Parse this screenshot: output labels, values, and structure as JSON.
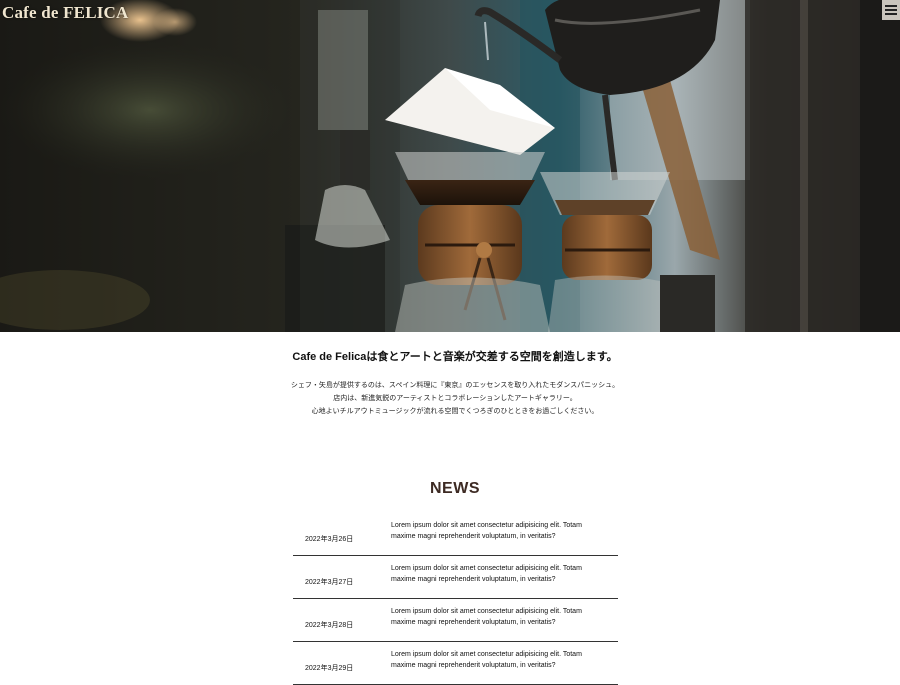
{
  "header": {
    "logo_text": "Cafe de FELICA",
    "menu_icon": "hamburger-menu-icon"
  },
  "hero": {
    "image_description_icon": "coffee-pour-over-photo"
  },
  "intro": {
    "title": "Cafe de Felicaは食とアートと音楽が交差する空間を創造します。",
    "lines": [
      "シェフ・矢島が提供するのは、スペイン料理に『東京』のエッセンスを取り入れたモダンスパニッシュ。",
      "店内は、新進気鋭のアーティストとコラボレーションしたアートギャラリー。",
      "心地よいチルアウトミュージックが流れる空間でくつろぎのひとときをお過ごしください。"
    ]
  },
  "news": {
    "title": "NEWS",
    "items": [
      {
        "date": "2022年3月26日",
        "text": "Lorem ipsum dolor sit amet consectetur adipisicing elit. Totam maxime magni reprehenderit voluptatum, in veritatis?"
      },
      {
        "date": "2022年3月27日",
        "text": "Lorem ipsum dolor sit amet consectetur adipisicing elit. Totam maxime magni reprehenderit voluptatum, in veritatis?"
      },
      {
        "date": "2022年3月28日",
        "text": "Lorem ipsum dolor sit amet consectetur adipisicing elit. Totam maxime magni reprehenderit voluptatum, in veritatis?"
      },
      {
        "date": "2022年3月29日",
        "text": "Lorem ipsum dolor sit amet consectetur adipisicing elit. Totam maxime magni reprehenderit voluptatum, in veritatis?"
      }
    ]
  },
  "colors": {
    "logo": "#f0e6cf",
    "news_title": "#3d2a23",
    "divider": "#333333"
  }
}
